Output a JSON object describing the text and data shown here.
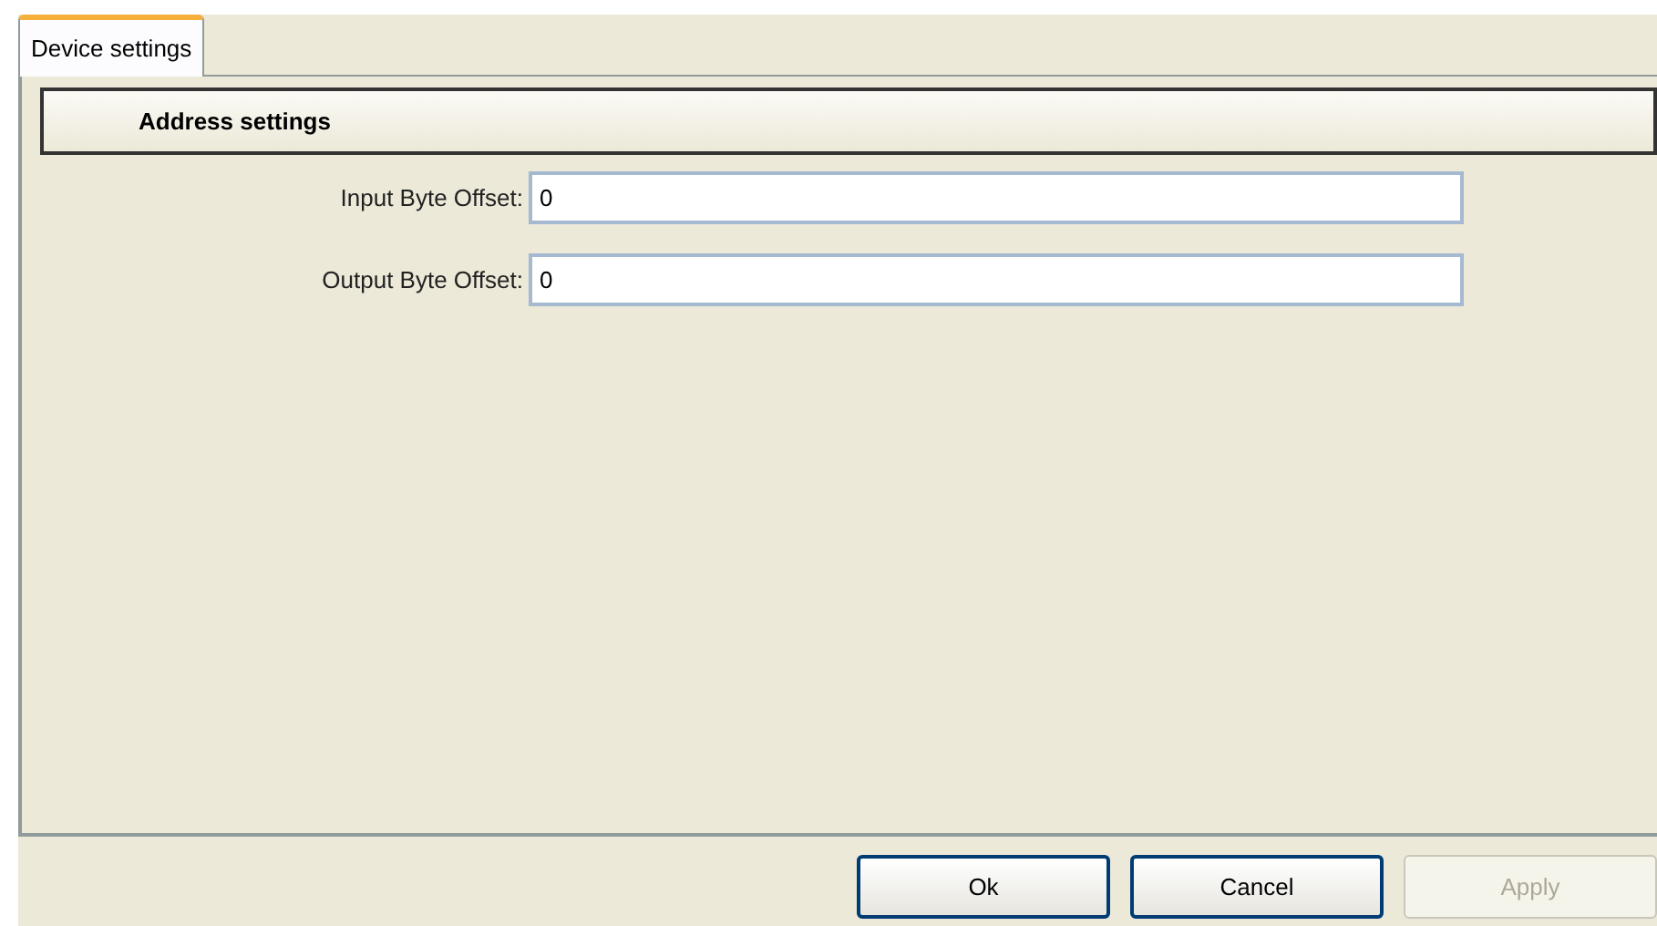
{
  "tabs": [
    {
      "label": "Device settings",
      "selected": true
    }
  ],
  "section": {
    "title": "Address settings"
  },
  "fields": [
    {
      "label": "Input Byte Offset:",
      "value": "0"
    },
    {
      "label": "Output Byte Offset:",
      "value": "0"
    }
  ],
  "buttons": [
    {
      "label": "Ok",
      "disabled": false
    },
    {
      "label": "Cancel",
      "disabled": false
    },
    {
      "label": "Apply",
      "disabled": true
    }
  ]
}
